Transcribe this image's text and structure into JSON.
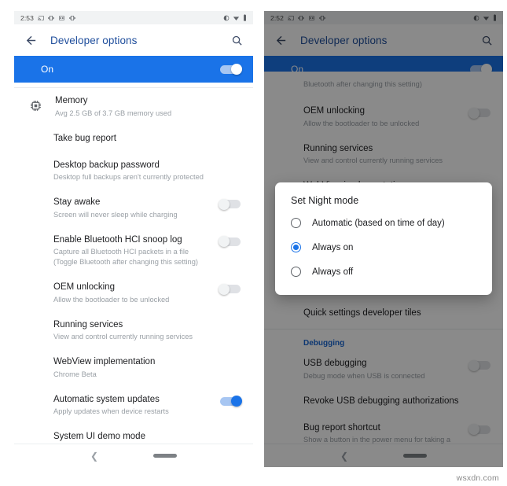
{
  "watermark": "wsxdn.com",
  "colors": {
    "accent_blue": "#1a73e8",
    "title_blue": "#1f4e9c",
    "section_blue": "#1967d2",
    "subtitle_gray": "#9aa0a6",
    "statusbar_bg": "#f1f3f4"
  },
  "left_phone": {
    "status": {
      "clock": "2:53",
      "left_icons": [
        "cast-icon",
        "vibrate-icon",
        "screenshot-icon",
        "vibrate-icon-2"
      ],
      "right_icons": [
        "do-not-disturb-icon",
        "wifi-icon",
        "battery-icon"
      ]
    },
    "appbar": {
      "back_icon": "back-arrow-icon",
      "title": "Developer options",
      "search_icon": "search-icon"
    },
    "master_toggle": {
      "label": "On",
      "state": "on"
    },
    "rows": [
      {
        "icon": "memory-chip-icon",
        "title": "Memory",
        "subtitle": "Avg 2.5 GB of 3.7 GB memory used",
        "control": "none"
      },
      {
        "icon": null,
        "title": "Take bug report",
        "subtitle": "",
        "control": "none"
      },
      {
        "icon": null,
        "title": "Desktop backup password",
        "subtitle": "Desktop full backups aren't currently protected",
        "control": "none"
      },
      {
        "icon": null,
        "title": "Stay awake",
        "subtitle": "Screen will never sleep while charging",
        "control": "switch-off"
      },
      {
        "icon": null,
        "title": "Enable Bluetooth HCI snoop log",
        "subtitle": "Capture all Bluetooth HCI packets in a file (Toggle Bluetooth after changing this setting)",
        "control": "switch-off"
      },
      {
        "icon": null,
        "title": "OEM unlocking",
        "subtitle": "Allow the bootloader to be unlocked",
        "control": "switch-off"
      },
      {
        "icon": null,
        "title": "Running services",
        "subtitle": "View and control currently running services",
        "control": "none"
      },
      {
        "icon": null,
        "title": "WebView implementation",
        "subtitle": "Chrome Beta",
        "control": "none"
      },
      {
        "icon": null,
        "title": "Automatic system updates",
        "subtitle": "Apply updates when device restarts",
        "control": "switch-on"
      },
      {
        "icon": null,
        "title": "System UI demo mode",
        "subtitle": "",
        "control": "none"
      }
    ],
    "navbar": {
      "back_icon": "nav-back-icon",
      "home_icon": "nav-home-pill"
    }
  },
  "right_phone": {
    "status": {
      "clock": "2:52",
      "left_icons": [
        "cast-icon",
        "vibrate-icon",
        "screenshot-icon",
        "vibrate-icon-2"
      ],
      "right_icons": [
        "do-not-disturb-icon",
        "wifi-icon",
        "battery-icon"
      ]
    },
    "appbar": {
      "back_icon": "back-arrow-icon",
      "title": "Developer options",
      "search_icon": "search-icon"
    },
    "master_toggle": {
      "label": "On",
      "state": "on"
    },
    "rows": [
      {
        "title": "",
        "subtitle": "Bluetooth after changing this setting)",
        "control": "none"
      },
      {
        "title": "OEM unlocking",
        "subtitle": "Allow the bootloader to be unlocked",
        "control": "switch-off"
      },
      {
        "title": "Running services",
        "subtitle": "View and control currently running services",
        "control": "none"
      },
      {
        "title": "WebView implementation",
        "subtitle": "",
        "control": "none"
      },
      {
        "title": "",
        "subtitle": "Always on",
        "control": "none"
      },
      {
        "title": "Quick settings developer tiles",
        "subtitle": "",
        "control": "none"
      }
    ],
    "section_debugging": "Debugging",
    "debug_rows": [
      {
        "title": "USB debugging",
        "subtitle": "Debug mode when USB is connected",
        "control": "switch-off"
      },
      {
        "title": "Revoke USB debugging authorizations",
        "subtitle": "",
        "control": "none"
      },
      {
        "title": "Bug report shortcut",
        "subtitle": "Show a button in the power menu for taking a bug",
        "control": "switch-off"
      }
    ],
    "dialog": {
      "title": "Set Night mode",
      "options": [
        {
          "label": "Automatic (based on time of day)",
          "selected": false
        },
        {
          "label": "Always on",
          "selected": true
        },
        {
          "label": "Always off",
          "selected": false
        }
      ]
    },
    "navbar": {
      "back_icon": "nav-back-icon",
      "home_icon": "nav-home-pill"
    }
  }
}
